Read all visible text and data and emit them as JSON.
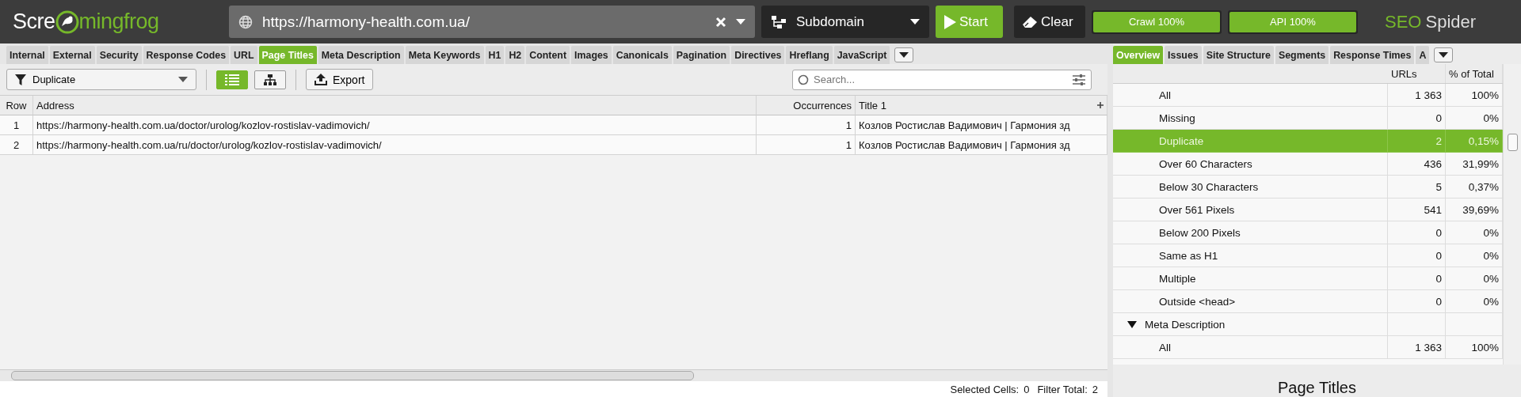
{
  "topbar": {
    "logo": [
      "Scre",
      "mingfrog"
    ],
    "url": "https://harmony-health.com.ua/",
    "mode": "Subdomain",
    "start": "Start",
    "clear": "Clear",
    "progress": [
      {
        "label": "Crawl 100%",
        "level": 1
      },
      {
        "label": "API 100%",
        "level": 1
      }
    ],
    "brand": {
      "highlight": "SEO",
      "text": "Spider"
    }
  },
  "tabs_left": [
    {
      "label": "Internal",
      "selected": false
    },
    {
      "label": "External",
      "selected": false
    },
    {
      "label": "Security",
      "selected": false
    },
    {
      "label": "Response Codes",
      "selected": false
    },
    {
      "label": "URL",
      "selected": false
    },
    {
      "label": "Page Titles",
      "selected": true
    },
    {
      "label": "Meta Description",
      "selected": false
    },
    {
      "label": "Meta Keywords",
      "selected": false
    },
    {
      "label": "H1",
      "selected": false
    },
    {
      "label": "H2",
      "selected": false
    },
    {
      "label": "Content",
      "selected": false
    },
    {
      "label": "Images",
      "selected": false
    },
    {
      "label": "Canonicals",
      "selected": false
    },
    {
      "label": "Pagination",
      "selected": false
    },
    {
      "label": "Directives",
      "selected": false
    },
    {
      "label": "Hreflang",
      "selected": false
    },
    {
      "label": "JavaScript",
      "selected": false
    }
  ],
  "tabs_right": [
    {
      "label": "Overview",
      "selected": true
    },
    {
      "label": "Issues",
      "selected": false
    },
    {
      "label": "Site Structure",
      "selected": false
    },
    {
      "label": "Segments",
      "selected": false
    },
    {
      "label": "Response Times",
      "selected": false
    },
    {
      "label": "A",
      "selected": false
    }
  ],
  "toolbar": {
    "filter": "Duplicate",
    "views": [
      {
        "kind": "list",
        "selected": true
      },
      {
        "kind": "tree",
        "selected": false
      }
    ],
    "export": "Export",
    "search": {
      "placeholder": "Search..."
    }
  },
  "table": {
    "columns": [
      "Row",
      "Address",
      "Occurrences",
      "Title 1"
    ],
    "rows": [
      [
        "1",
        "https://harmony-health.com.ua/doctor/urolog/kozlov-rostislav-vadimovich/",
        "1",
        "Козлов Ростислав Вадимович | Гармония зд"
      ],
      [
        "2",
        "https://harmony-health.com.ua/ru/doctor/urolog/kozlov-rostislav-vadimovich/",
        "1",
        "Козлов Ростислав Вадимович | Гармония зд"
      ]
    ]
  },
  "status_bar": [
    {
      "label": "Selected Cells:",
      "value": "0"
    },
    {
      "label": "Filter Total:",
      "value": "2"
    }
  ],
  "overview": {
    "columns": [
      "URLs",
      "% of Total"
    ],
    "rows": [
      {
        "label": "All",
        "urls": "1 363",
        "percent": "100%",
        "selected": false
      },
      {
        "label": "Missing",
        "urls": "0",
        "percent": "0%",
        "selected": false
      },
      {
        "label": "Duplicate",
        "urls": "2",
        "percent": "0,15%",
        "selected": true
      },
      {
        "label": "Over 60 Characters",
        "urls": "436",
        "percent": "31,99%",
        "selected": false
      },
      {
        "label": "Below 30 Characters",
        "urls": "5",
        "percent": "0,37%",
        "selected": false
      },
      {
        "label": "Over 561 Pixels",
        "urls": "541",
        "percent": "39,69%",
        "selected": false
      },
      {
        "label": "Below 200 Pixels",
        "urls": "0",
        "percent": "0%",
        "selected": false
      },
      {
        "label": "Same as H1",
        "urls": "0",
        "percent": "0%",
        "selected": false
      },
      {
        "label": "Multiple",
        "urls": "0",
        "percent": "0%",
        "selected": false
      },
      {
        "label": "Outside <head>",
        "urls": "0",
        "percent": "0%",
        "selected": false
      },
      {
        "label": "Meta Description",
        "selected": false,
        "expanded": true,
        "children": [
          {
            "label": "All",
            "urls": "1 363",
            "percent": "100%",
            "selected": false
          }
        ]
      }
    ],
    "heading": "Page Titles"
  }
}
